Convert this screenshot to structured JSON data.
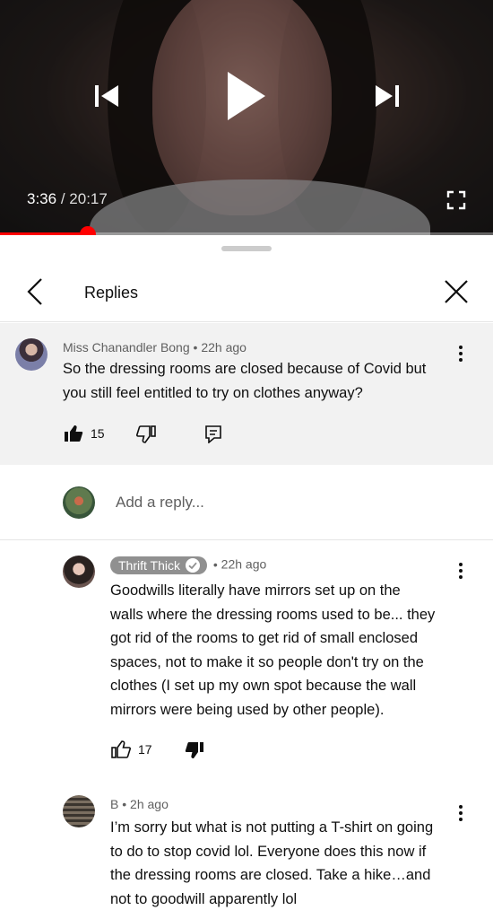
{
  "player": {
    "current_time": "3:36",
    "separator": "/",
    "duration": "20:17",
    "progress_fraction": 0.178,
    "icons": [
      "previous-icon",
      "play-icon",
      "next-icon",
      "fullscreen-icon"
    ]
  },
  "header": {
    "title": "Replies",
    "icons": [
      "back-arrow-icon",
      "close-icon"
    ]
  },
  "parent_comment": {
    "author": "Miss Chanandler Bong",
    "dot": "•",
    "age": "22h ago",
    "text_lines": [
      "So the dressing rooms are closed because of Covid but",
      "you still feel entitled to try on clothes anyway?"
    ],
    "likes": "15",
    "liked": true
  },
  "reply_box": {
    "placeholder": "Add a reply..."
  },
  "replies": [
    {
      "author": "Thrift Thick",
      "verified": true,
      "dot": "•",
      "age": "22h ago",
      "text_lines": [
        "Goodwills literally have mirrors set up on the",
        "walls where the dressing rooms used to be... they",
        "got rid of the rooms to get rid of small enclosed",
        "spaces, not to make it so people don't try on the",
        "clothes (I set up my own spot because the wall",
        "mirrors were being used by other people)."
      ],
      "likes": "17",
      "disliked": true
    },
    {
      "author": "B",
      "dot": "•",
      "age": "2h ago",
      "text_lines": [
        "I’m sorry but what is not putting a T-shirt on going",
        "to do to stop covid lol. Everyone does this now if",
        "the dressing rooms are closed. Take a hike…and",
        "not to goodwill apparently lol"
      ]
    }
  ],
  "colors": {
    "accent_red": "#ff0000",
    "parent_bg": "#f2f2f2",
    "meta_gray": "#606060",
    "badge_gray": "#909090"
  }
}
